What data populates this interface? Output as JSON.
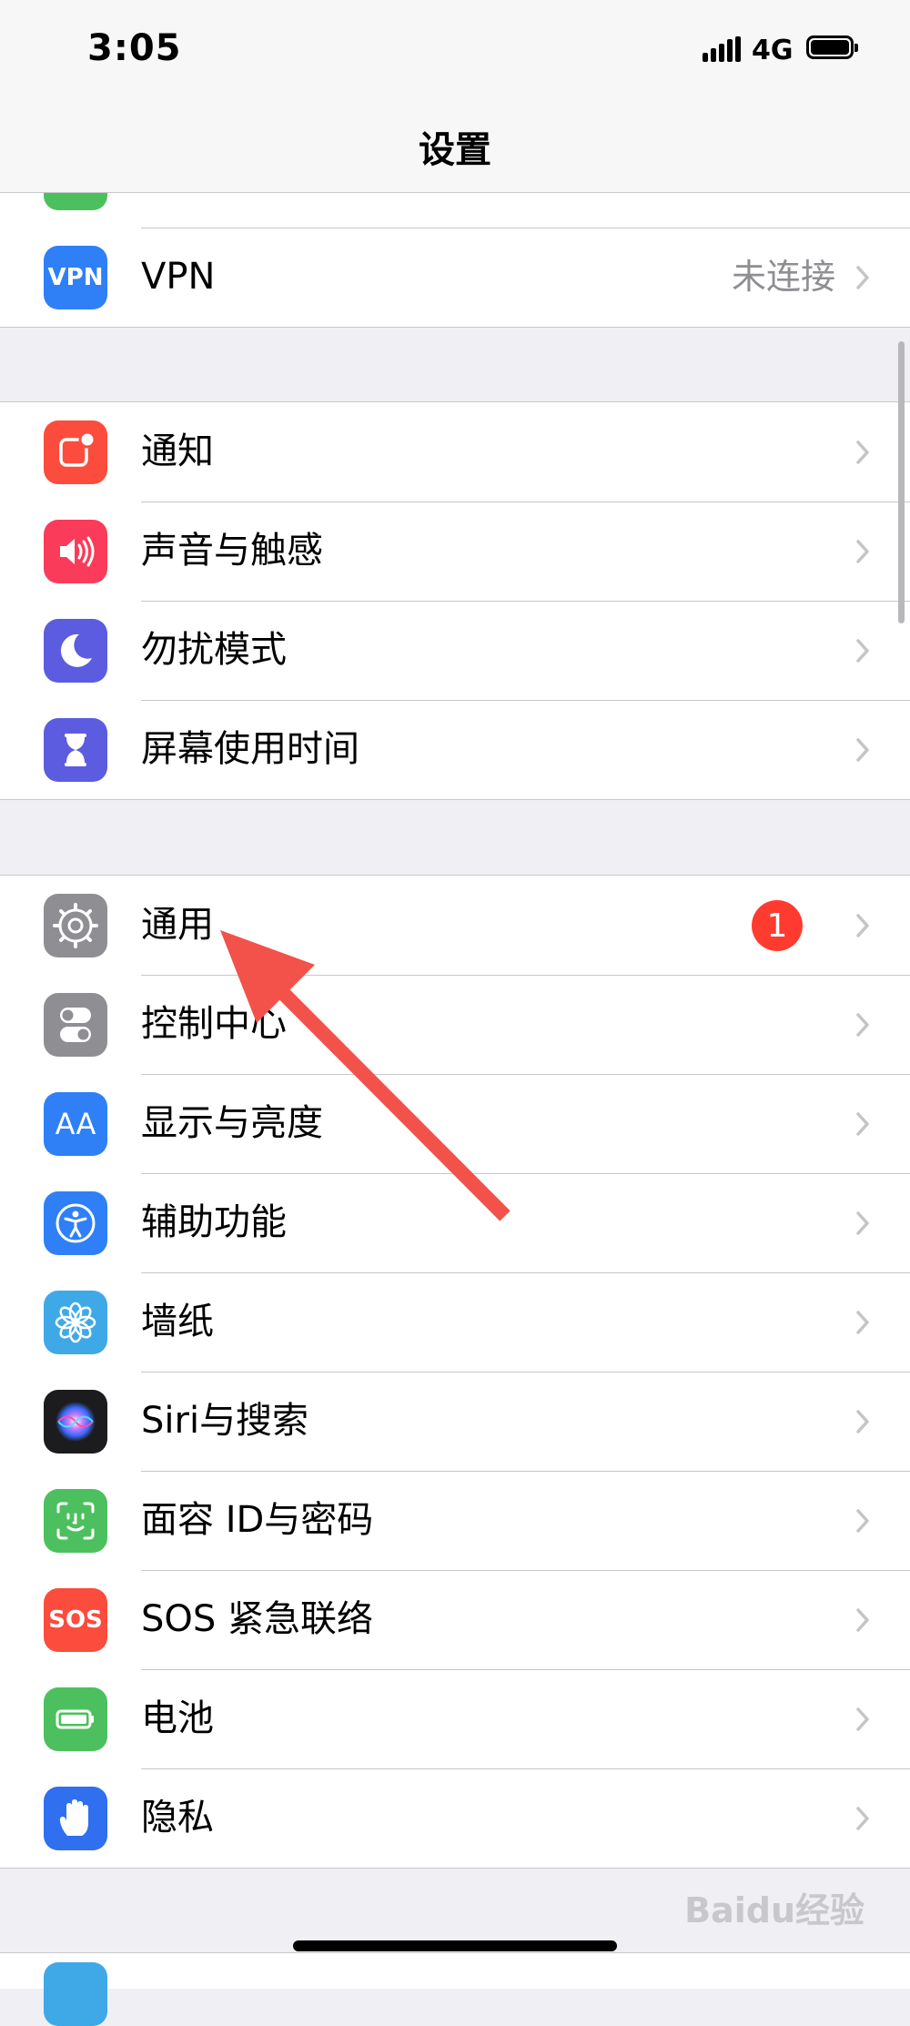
{
  "status_bar": {
    "time": "3:05",
    "network": "4G"
  },
  "navbar": {
    "title": "设置"
  },
  "group1": {
    "items": [
      {
        "label": "",
        "value": ""
      },
      {
        "label": "VPN",
        "value": "未连接",
        "icon_text": "VPN",
        "icon": "vpn-icon",
        "color": "#2f80f7"
      }
    ]
  },
  "group2": {
    "items": [
      {
        "label": "通知",
        "icon": "notification-icon",
        "color": "#fb4c3d"
      },
      {
        "label": "声音与触感",
        "icon": "speaker-icon",
        "color": "#fb3b5a"
      },
      {
        "label": "勿扰模式",
        "icon": "moon-icon",
        "color": "#5c5ce0"
      },
      {
        "label": "屏幕使用时间",
        "icon": "hourglass-icon",
        "color": "#5c5ce0"
      }
    ]
  },
  "group3": {
    "items": [
      {
        "label": "通用",
        "badge": "1",
        "icon": "gear-icon",
        "color": "#8e8e93"
      },
      {
        "label": "控制中心",
        "icon": "toggles-icon",
        "color": "#8e8e93"
      },
      {
        "label": "显示与亮度",
        "icon_text": "AA",
        "icon": "text-size-icon",
        "color": "#2f80f7"
      },
      {
        "label": "辅助功能",
        "icon": "accessibility-icon",
        "color": "#2f80f7"
      },
      {
        "label": "墙纸",
        "icon": "flower-icon",
        "color": "#3fa9e8"
      },
      {
        "label": "Siri与搜索",
        "icon": "siri-icon",
        "color": "#1c1c1e"
      },
      {
        "label": "面容 ID与密码",
        "icon": "face-id-icon",
        "color": "#4cc05e"
      },
      {
        "label": "SOS 紧急联络",
        "icon_text": "SOS",
        "icon": "sos-icon",
        "color": "#fb4c3d"
      },
      {
        "label": "电池",
        "icon": "battery-icon",
        "color": "#4cc05e"
      },
      {
        "label": "隐私",
        "icon": "hand-icon",
        "color": "#2f6ff0"
      }
    ]
  },
  "watermark": {
    "text": "Baidu经验"
  }
}
